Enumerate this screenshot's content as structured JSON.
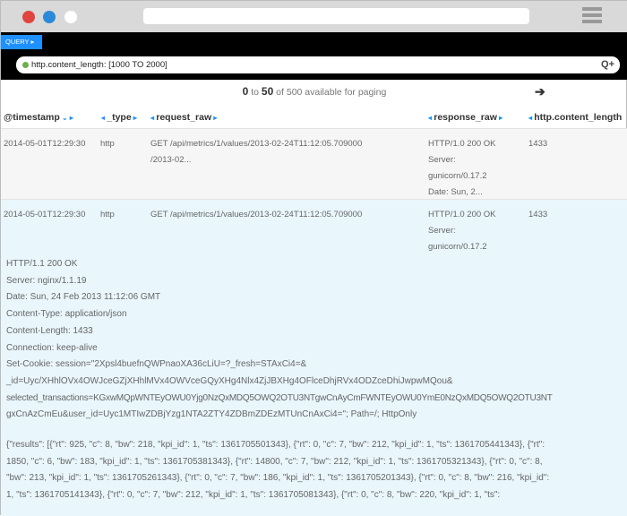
{
  "colors": {
    "accent": "#1e90ff",
    "status_dot": "#6ab04c",
    "expanded_row_bg": "#e9f6fc"
  },
  "query": {
    "tab_label": "QUERY ▸",
    "value": "http.content_length: [1000 TO 2000]",
    "icons": "Q+"
  },
  "paging": {
    "from": "0",
    "to_word": " to ",
    "to": "50",
    "rest": " of 500 available for paging",
    "next_icon": "➔"
  },
  "columns": [
    {
      "label": "@timestamp",
      "icon": " ⌄ ▸"
    },
    {
      "label": "_type",
      "icon": " ▸"
    },
    {
      "label": "request_raw",
      "icon": " ▸"
    },
    {
      "label": "response_raw",
      "icon": " ▸"
    },
    {
      "label": "http.content_length"
    }
  ],
  "col_prefix": "◂ ",
  "rows": [
    {
      "timestamp": "2014-05-01T12:29:30",
      "type": "http",
      "request": [
        "GET /api/metrics/1/values/2013-02-24T11:12:05.709000",
        "/2013-02..."
      ],
      "response": [
        "HTTP/1.0 200 OK",
        "Server:",
        "gunicorn/0.17.2",
        "Date: Sun, 2..."
      ],
      "length": "1433"
    },
    {
      "timestamp": "2014-05-01T12:29:30",
      "type": "http",
      "request": [
        "GET /api/metrics/1/values/2013-02-24T11:12:05.709000"
      ],
      "response": [
        "HTTP/1.0 200 OK",
        "Server:",
        "gunicorn/0.17.2"
      ],
      "length": "1433"
    }
  ],
  "expanded": {
    "headers": [
      "HTTP/1.1 200 OK",
      "Server: nginx/1.1.19",
      "Date: Sun, 24 Feb 2013 11:12:06 GMT",
      "Content-Type: application/json",
      "Content-Length: 1433",
      "Connection: keep-alive",
      "Set-Cookie: session=\"2Xpsl4buefnQWPnaoXA36cLiU=?_fresh=STAxCi4=&",
      "_id=Uyc/XHhlOVx4OWJceGZjXHhlMVx4OWVceGQyXHg4Nlx4ZjJBXHg4OFlceDhjRVx4ODZceDhiJwpwMQou&",
      "selected_transactions=KGxwMQpWNTEyOWU0Yjg0NzQxMDQ5OWQ2OTU3NTgwCnAyCmFWNTEyOWU0YmE0NzQxMDQ5OWQ2OTU3NT",
      "gxCnAzCmEu&user_id=Uyc1MTIwZDBjYzg1NTA2ZTY4ZDBmZDEzMTUnCnAxCi4=\"; Path=/; HttpOnly"
    ],
    "body": [
      "{\"results\": [{\"rt\": 925, \"c\": 8, \"bw\": 218, \"kpi_id\": 1, \"ts\": 1361705501343}, {\"rt\": 0, \"c\": 7, \"bw\": 212, \"kpi_id\": 1, \"ts\": 1361705441343}, {\"rt\":",
      "1850, \"c\": 6, \"bw\": 183, \"kpi_id\": 1, \"ts\": 1361705381343}, {\"rt\": 14800, \"c\": 7, \"bw\": 212, \"kpi_id\": 1, \"ts\": 1361705321343}, {\"rt\": 0, \"c\": 8,",
      "\"bw\": 213, \"kpi_id\": 1, \"ts\": 1361705261343}, {\"rt\": 0, \"c\": 7, \"bw\": 186, \"kpi_id\": 1, \"ts\": 1361705201343}, {\"rt\": 0, \"c\": 8, \"bw\": 216, \"kpi_id\":",
      "1, \"ts\": 1361705141343}, {\"rt\": 0, \"c\": 7, \"bw\": 212, \"kpi_id\": 1, \"ts\": 1361705081343}, {\"rt\": 0, \"c\": 8, \"bw\": 220, \"kpi_id\": 1, \"ts\":"
    ]
  }
}
